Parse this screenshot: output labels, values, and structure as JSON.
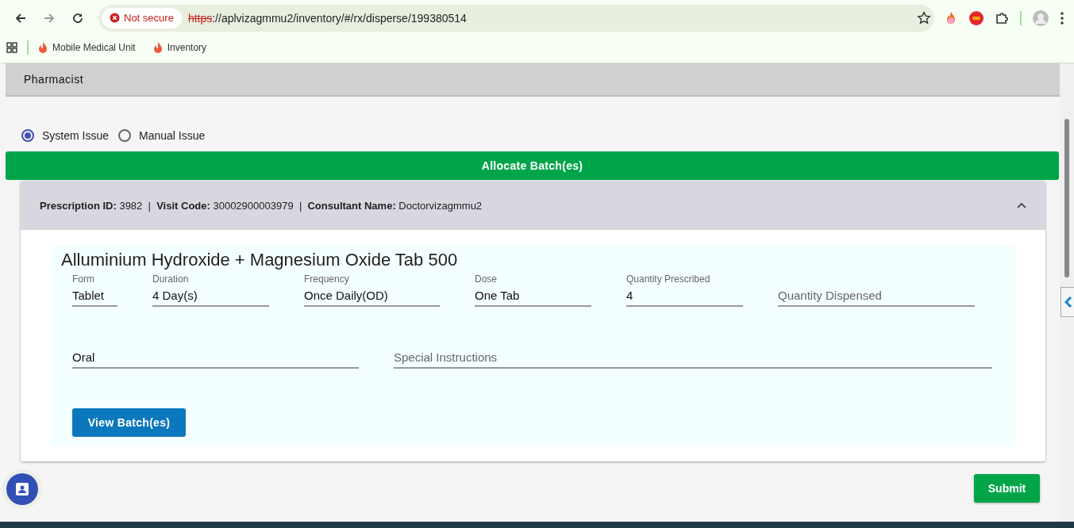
{
  "browser": {
    "security": "Not secure",
    "url_scheme": "https",
    "url_rest": "://aplvizagmmu2/inventory/#/rx/disperse/199380514",
    "bookmarks": [
      "Mobile Medical Unit",
      "Inventory"
    ]
  },
  "header": {
    "title": "Pharmacist"
  },
  "issue_options": [
    {
      "label": "System Issue",
      "selected": true
    },
    {
      "label": "Manual Issue",
      "selected": false
    }
  ],
  "allocate_button": "Allocate Batch(es)",
  "prescription": {
    "summary": "**Prescription ID:** 3982  |  **Visit Code:** 30002900003979  |  **Consultant Name:** Doctorvizagmmu2",
    "expanded": true,
    "drug": "Alluminium Hydroxide + Magnesium Oxide Tab 500",
    "fields": [
      {
        "label": "Form",
        "value": "Tablet"
      },
      {
        "label": "Duration",
        "value": "4 Day(s)"
      },
      {
        "label": "Frequency",
        "value": "Once Daily(OD)"
      },
      {
        "label": "Dose",
        "value": "One Tab"
      },
      {
        "label": "Quantity Prescribed",
        "value": "4"
      },
      {
        "placeholder": "Quantity Dispensed"
      }
    ],
    "fields_2": [
      {
        "value": "Oral"
      },
      {
        "placeholder": "Special Instructions"
      }
    ],
    "view_button": "View Batch(es)"
  },
  "submit_button": "Submit"
}
